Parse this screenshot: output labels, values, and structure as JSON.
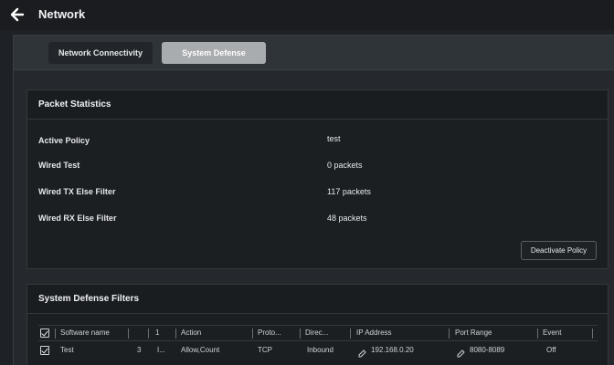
{
  "header": {
    "title": "Network"
  },
  "tabs": [
    {
      "label": "Network Connectivity",
      "active": false
    },
    {
      "label": "System Defense",
      "active": true
    }
  ],
  "packet_statistics": {
    "title": "Packet Statistics",
    "rows": [
      {
        "label": "Active Policy",
        "value": "test"
      },
      {
        "label": "Wired Test",
        "value": "0 packets"
      },
      {
        "label": "Wired TX Else Filter",
        "value": "117 packets"
      },
      {
        "label": "Wired RX Else Filter",
        "value": "48 packets"
      }
    ],
    "deactivate_label": "Deactivate Policy"
  },
  "filters": {
    "title": "System Defense Filters",
    "columns": [
      "Software name",
      "1",
      "Action",
      "Proto...",
      "Direc...",
      "IP Address",
      "Port Range",
      "Event"
    ],
    "rows": [
      {
        "name": "Test",
        "num": "3",
        "col2": "I...",
        "action": "Allow,Count",
        "proto": "TCP",
        "direction": "Inbound",
        "ip": "192.168.0.20",
        "port": "8080-8089",
        "event": "Off"
      }
    ]
  },
  "colors": {
    "active_tab": "#a9acaf",
    "background": "#1e2125",
    "panel": "#1c1f22"
  },
  "icons": {
    "back": "arrow-left-icon",
    "edit": "edit-icon",
    "checkbox": "checkbox-checked-icon"
  }
}
